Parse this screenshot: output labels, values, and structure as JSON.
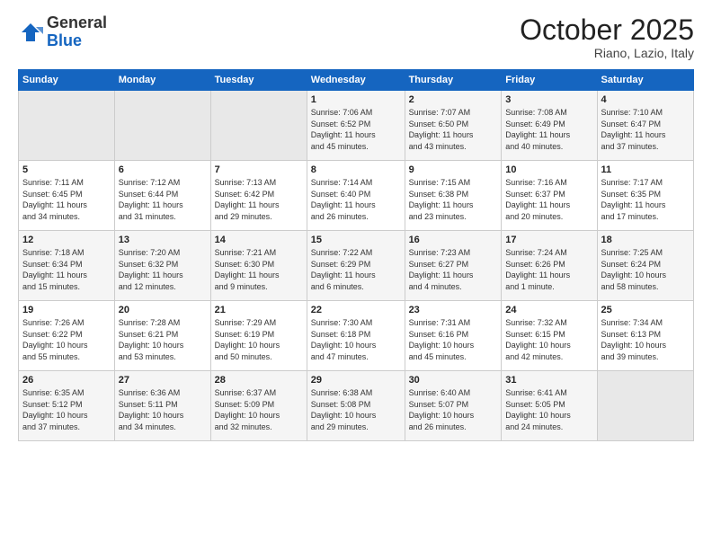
{
  "logo": {
    "general": "General",
    "blue": "Blue"
  },
  "header": {
    "month": "October 2025",
    "location": "Riano, Lazio, Italy"
  },
  "weekdays": [
    "Sunday",
    "Monday",
    "Tuesday",
    "Wednesday",
    "Thursday",
    "Friday",
    "Saturday"
  ],
  "weeks": [
    [
      {
        "day": "",
        "info": ""
      },
      {
        "day": "",
        "info": ""
      },
      {
        "day": "",
        "info": ""
      },
      {
        "day": "1",
        "info": "Sunrise: 7:06 AM\nSunset: 6:52 PM\nDaylight: 11 hours\nand 45 minutes."
      },
      {
        "day": "2",
        "info": "Sunrise: 7:07 AM\nSunset: 6:50 PM\nDaylight: 11 hours\nand 43 minutes."
      },
      {
        "day": "3",
        "info": "Sunrise: 7:08 AM\nSunset: 6:49 PM\nDaylight: 11 hours\nand 40 minutes."
      },
      {
        "day": "4",
        "info": "Sunrise: 7:10 AM\nSunset: 6:47 PM\nDaylight: 11 hours\nand 37 minutes."
      }
    ],
    [
      {
        "day": "5",
        "info": "Sunrise: 7:11 AM\nSunset: 6:45 PM\nDaylight: 11 hours\nand 34 minutes."
      },
      {
        "day": "6",
        "info": "Sunrise: 7:12 AM\nSunset: 6:44 PM\nDaylight: 11 hours\nand 31 minutes."
      },
      {
        "day": "7",
        "info": "Sunrise: 7:13 AM\nSunset: 6:42 PM\nDaylight: 11 hours\nand 29 minutes."
      },
      {
        "day": "8",
        "info": "Sunrise: 7:14 AM\nSunset: 6:40 PM\nDaylight: 11 hours\nand 26 minutes."
      },
      {
        "day": "9",
        "info": "Sunrise: 7:15 AM\nSunset: 6:38 PM\nDaylight: 11 hours\nand 23 minutes."
      },
      {
        "day": "10",
        "info": "Sunrise: 7:16 AM\nSunset: 6:37 PM\nDaylight: 11 hours\nand 20 minutes."
      },
      {
        "day": "11",
        "info": "Sunrise: 7:17 AM\nSunset: 6:35 PM\nDaylight: 11 hours\nand 17 minutes."
      }
    ],
    [
      {
        "day": "12",
        "info": "Sunrise: 7:18 AM\nSunset: 6:34 PM\nDaylight: 11 hours\nand 15 minutes."
      },
      {
        "day": "13",
        "info": "Sunrise: 7:20 AM\nSunset: 6:32 PM\nDaylight: 11 hours\nand 12 minutes."
      },
      {
        "day": "14",
        "info": "Sunrise: 7:21 AM\nSunset: 6:30 PM\nDaylight: 11 hours\nand 9 minutes."
      },
      {
        "day": "15",
        "info": "Sunrise: 7:22 AM\nSunset: 6:29 PM\nDaylight: 11 hours\nand 6 minutes."
      },
      {
        "day": "16",
        "info": "Sunrise: 7:23 AM\nSunset: 6:27 PM\nDaylight: 11 hours\nand 4 minutes."
      },
      {
        "day": "17",
        "info": "Sunrise: 7:24 AM\nSunset: 6:26 PM\nDaylight: 11 hours\nand 1 minute."
      },
      {
        "day": "18",
        "info": "Sunrise: 7:25 AM\nSunset: 6:24 PM\nDaylight: 10 hours\nand 58 minutes."
      }
    ],
    [
      {
        "day": "19",
        "info": "Sunrise: 7:26 AM\nSunset: 6:22 PM\nDaylight: 10 hours\nand 55 minutes."
      },
      {
        "day": "20",
        "info": "Sunrise: 7:28 AM\nSunset: 6:21 PM\nDaylight: 10 hours\nand 53 minutes."
      },
      {
        "day": "21",
        "info": "Sunrise: 7:29 AM\nSunset: 6:19 PM\nDaylight: 10 hours\nand 50 minutes."
      },
      {
        "day": "22",
        "info": "Sunrise: 7:30 AM\nSunset: 6:18 PM\nDaylight: 10 hours\nand 47 minutes."
      },
      {
        "day": "23",
        "info": "Sunrise: 7:31 AM\nSunset: 6:16 PM\nDaylight: 10 hours\nand 45 minutes."
      },
      {
        "day": "24",
        "info": "Sunrise: 7:32 AM\nSunset: 6:15 PM\nDaylight: 10 hours\nand 42 minutes."
      },
      {
        "day": "25",
        "info": "Sunrise: 7:34 AM\nSunset: 6:13 PM\nDaylight: 10 hours\nand 39 minutes."
      }
    ],
    [
      {
        "day": "26",
        "info": "Sunrise: 6:35 AM\nSunset: 5:12 PM\nDaylight: 10 hours\nand 37 minutes."
      },
      {
        "day": "27",
        "info": "Sunrise: 6:36 AM\nSunset: 5:11 PM\nDaylight: 10 hours\nand 34 minutes."
      },
      {
        "day": "28",
        "info": "Sunrise: 6:37 AM\nSunset: 5:09 PM\nDaylight: 10 hours\nand 32 minutes."
      },
      {
        "day": "29",
        "info": "Sunrise: 6:38 AM\nSunset: 5:08 PM\nDaylight: 10 hours\nand 29 minutes."
      },
      {
        "day": "30",
        "info": "Sunrise: 6:40 AM\nSunset: 5:07 PM\nDaylight: 10 hours\nand 26 minutes."
      },
      {
        "day": "31",
        "info": "Sunrise: 6:41 AM\nSunset: 5:05 PM\nDaylight: 10 hours\nand 24 minutes."
      },
      {
        "day": "",
        "info": ""
      }
    ]
  ]
}
